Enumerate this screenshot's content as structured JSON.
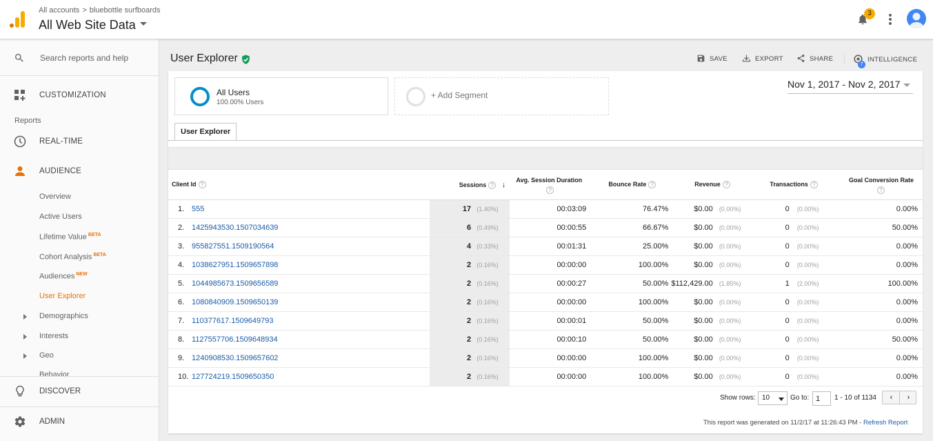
{
  "header": {
    "breadcrumb_account": "All accounts",
    "breadcrumb_sep": ">",
    "breadcrumb_property": "bluebottle surfboards",
    "view_name": "All Web Site Data",
    "notification_count": "3"
  },
  "sidebar": {
    "search_placeholder": "Search reports and help",
    "customization": "CUSTOMIZATION",
    "reports_label": "Reports",
    "realtime": "REAL-TIME",
    "audience": "AUDIENCE",
    "audience_items": [
      {
        "label": "Overview",
        "badge": ""
      },
      {
        "label": "Active Users",
        "badge": ""
      },
      {
        "label": "Lifetime Value",
        "badge": "BETA"
      },
      {
        "label": "Cohort Analysis",
        "badge": "BETA"
      },
      {
        "label": "Audiences",
        "badge": "NEW"
      },
      {
        "label": "User Explorer",
        "badge": ""
      }
    ],
    "collapsible_items": [
      "Demographics",
      "Interests",
      "Geo",
      "Behavior"
    ],
    "discover": "DISCOVER",
    "admin": "ADMIN"
  },
  "page": {
    "title": "User Explorer",
    "toolbar": {
      "save": "SAVE",
      "export": "EXPORT",
      "share": "SHARE",
      "intelligence": "INTELLIGENCE",
      "intelligence_badge": "7"
    },
    "segment": {
      "name": "All Users",
      "subtitle": "100.00% Users",
      "add_label": "+ Add Segment"
    },
    "date_range": "Nov 1, 2017 - Nov 2, 2017",
    "tab": "User Explorer"
  },
  "table": {
    "headers": {
      "client_id": "Client Id",
      "sessions": "Sessions",
      "avg_session_duration": "Avg. Session Duration",
      "bounce_rate": "Bounce Rate",
      "revenue": "Revenue",
      "transactions": "Transactions",
      "goal_conversion_rate": "Goal Conversion Rate"
    },
    "help_glyph": "?",
    "sort_glyph": "↓",
    "rows": [
      {
        "num": "1.",
        "client_id": "555",
        "sessions": "17",
        "sessions_pct": "(1.40%)",
        "duration": "00:03:09",
        "bounce": "76.47%",
        "revenue": "$0.00",
        "revenue_pct": "(0.00%)",
        "transactions": "0",
        "transactions_pct": "(0.00%)",
        "goal": "0.00%"
      },
      {
        "num": "2.",
        "client_id": "1425943530.1507034639",
        "sessions": "6",
        "sessions_pct": "(0.49%)",
        "duration": "00:00:55",
        "bounce": "66.67%",
        "revenue": "$0.00",
        "revenue_pct": "(0.00%)",
        "transactions": "0",
        "transactions_pct": "(0.00%)",
        "goal": "50.00%"
      },
      {
        "num": "3.",
        "client_id": "955827551.1509190564",
        "sessions": "4",
        "sessions_pct": "(0.33%)",
        "duration": "00:01:31",
        "bounce": "25.00%",
        "revenue": "$0.00",
        "revenue_pct": "(0.00%)",
        "transactions": "0",
        "transactions_pct": "(0.00%)",
        "goal": "0.00%"
      },
      {
        "num": "4.",
        "client_id": "1038627951.1509657898",
        "sessions": "2",
        "sessions_pct": "(0.16%)",
        "duration": "00:00:00",
        "bounce": "100.00%",
        "revenue": "$0.00",
        "revenue_pct": "(0.00%)",
        "transactions": "0",
        "transactions_pct": "(0.00%)",
        "goal": "0.00%"
      },
      {
        "num": "5.",
        "client_id": "1044985673.1509656589",
        "sessions": "2",
        "sessions_pct": "(0.16%)",
        "duration": "00:00:27",
        "bounce": "50.00%",
        "revenue": "$112,429.00",
        "revenue_pct": "(1.85%)",
        "transactions": "1",
        "transactions_pct": "(2.00%)",
        "goal": "100.00%"
      },
      {
        "num": "6.",
        "client_id": "1080840909.1509650139",
        "sessions": "2",
        "sessions_pct": "(0.16%)",
        "duration": "00:00:00",
        "bounce": "100.00%",
        "revenue": "$0.00",
        "revenue_pct": "(0.00%)",
        "transactions": "0",
        "transactions_pct": "(0.00%)",
        "goal": "0.00%"
      },
      {
        "num": "7.",
        "client_id": "110377617.1509649793",
        "sessions": "2",
        "sessions_pct": "(0.16%)",
        "duration": "00:00:01",
        "bounce": "50.00%",
        "revenue": "$0.00",
        "revenue_pct": "(0.00%)",
        "transactions": "0",
        "transactions_pct": "(0.00%)",
        "goal": "0.00%"
      },
      {
        "num": "8.",
        "client_id": "1127557706.1509648934",
        "sessions": "2",
        "sessions_pct": "(0.16%)",
        "duration": "00:00:10",
        "bounce": "50.00%",
        "revenue": "$0.00",
        "revenue_pct": "(0.00%)",
        "transactions": "0",
        "transactions_pct": "(0.00%)",
        "goal": "50.00%"
      },
      {
        "num": "9.",
        "client_id": "1240908530.1509657602",
        "sessions": "2",
        "sessions_pct": "(0.16%)",
        "duration": "00:00:00",
        "bounce": "100.00%",
        "revenue": "$0.00",
        "revenue_pct": "(0.00%)",
        "transactions": "0",
        "transactions_pct": "(0.00%)",
        "goal": "0.00%"
      },
      {
        "num": "10.",
        "client_id": "127724219.1509650350",
        "sessions": "2",
        "sessions_pct": "(0.16%)",
        "duration": "00:00:00",
        "bounce": "100.00%",
        "revenue": "$0.00",
        "revenue_pct": "(0.00%)",
        "transactions": "0",
        "transactions_pct": "(0.00%)",
        "goal": "0.00%"
      }
    ]
  },
  "pagination": {
    "show_rows_label": "Show rows:",
    "show_rows_value": "10",
    "goto_label": "Go to:",
    "goto_value": "1",
    "range": "1 - 10 of 1134",
    "prev": "‹",
    "next": "›"
  },
  "footer": {
    "generated_text": "This report was generated on 11/2/17 at 11:26:43 PM -",
    "refresh_link": "Refresh Report"
  },
  "colors": {
    "accent_orange": "#e8710a",
    "link_blue": "#1a5ba6",
    "segment_blue": "#058dc7",
    "badge_yellow": "#f9ab00",
    "verified_green": "#0f9d58"
  }
}
